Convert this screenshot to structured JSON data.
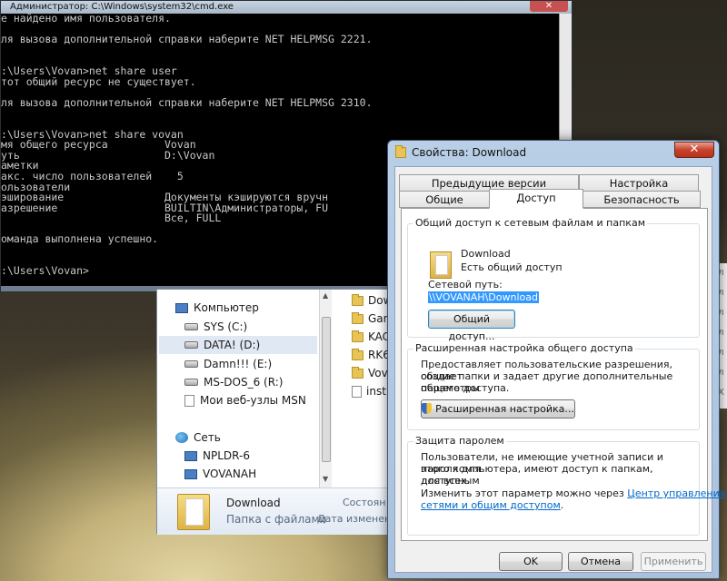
{
  "cmd": {
    "title": "Администратор: C:\\Windows\\system32\\cmd.exe",
    "close_label": "✕",
    "lines": [
      "е найдено имя пользователя.",
      "",
      "ля вызова дополнительной справки наберите NET HELPMSG 2221.",
      "",
      "",
      ":\\Users\\Vovan>net share user",
      "тот общий ресурс не существует.",
      "",
      "ля вызова дополнительной справки наберите NET HELPMSG 2310.",
      "",
      "",
      ":\\Users\\Vovan>net share vovan",
      "мя общего ресурса         Vovan",
      "уть                       D:\\Vovan",
      "аметки",
      "акс. число пользователей    5",
      "ользователи",
      "эширование                Документы кэшируются вручн",
      "азрешение                 BUILTIN\\Администраторы, FU",
      "                          Все, FULL",
      "",
      "оманда выполнена успешно.",
      "",
      "",
      ":\\Users\\Vovan>"
    ]
  },
  "explorer": {
    "nav": [
      {
        "label": "Компьютер",
        "icon": "computer-icon"
      },
      {
        "label": "SYS (C:)",
        "icon": "system-drive-icon"
      },
      {
        "label": "DATA! (D:)",
        "icon": "drive-icon"
      },
      {
        "label": "Damn!!! (E:)",
        "icon": "drive-icon"
      },
      {
        "label": "MS-DOS_6 (R:)",
        "icon": "drive-icon"
      },
      {
        "label": "Мои веб-узлы MSN",
        "icon": "document-icon"
      },
      {
        "label": "Сеть",
        "icon": "network-icon"
      },
      {
        "label": "NPLDR-6",
        "icon": "computer-icon"
      },
      {
        "label": "VOVANAH",
        "icon": "computer-icon"
      }
    ],
    "files": [
      {
        "label": "Dow",
        "icon": "folder-icon"
      },
      {
        "label": "Gan",
        "icon": "folder-icon"
      },
      {
        "label": "KAC",
        "icon": "folder-icon"
      },
      {
        "label": "RK6",
        "icon": "folder-icon"
      },
      {
        "label": "Vov",
        "icon": "folder-icon"
      },
      {
        "label": "inst",
        "icon": "document-icon"
      }
    ],
    "details": {
      "name": "Download",
      "type": "Папка с файлами",
      "k1": "Состоян",
      "k2": "Дата изменен"
    }
  },
  "dialog": {
    "title": "Свойства: Download",
    "close_label": "✕",
    "tabs_row1": [
      "Предыдущие версии",
      "Настройка"
    ],
    "tabs_row2": [
      "Общие",
      "Доступ",
      "Безопасность"
    ],
    "active_tab": "Доступ",
    "share_group": {
      "title": "Общий доступ к сетевым файлам и папкам",
      "item_name": "Download",
      "item_status": "Есть общий доступ",
      "net_path_label": "Сетевой путь:",
      "net_path": "\\\\VOVANAH\\Download",
      "share_button": "Общий доступ..."
    },
    "advanced_group": {
      "title": "Расширенная настройка общего доступа",
      "desc1": "Предоставляет пользовательские разрешения, создает",
      "desc2": "общие папки и задает другие дополнительные параметры",
      "desc3": "общего доступа.",
      "button": "Расширенная настройка..."
    },
    "password_group": {
      "title": "Защита паролем",
      "desc1": "Пользователи, не имеющие учетной записи и пароля для",
      "desc2": "этого компьютера, имеют доступ к папкам, доступным",
      "desc3": "для всех.",
      "change_prefix": "Изменить этот параметр можно через ",
      "link1": "Центр управления",
      "link2": "сетями и общим доступом",
      "suffix": "."
    },
    "buttons": {
      "ok": "OK",
      "cancel": "Отмена",
      "apply": "Применить"
    }
  },
  "bg_strip": [
    "ол",
    "ол",
    "ол",
    "ол",
    "ол",
    "ол",
    "ТХ"
  ]
}
